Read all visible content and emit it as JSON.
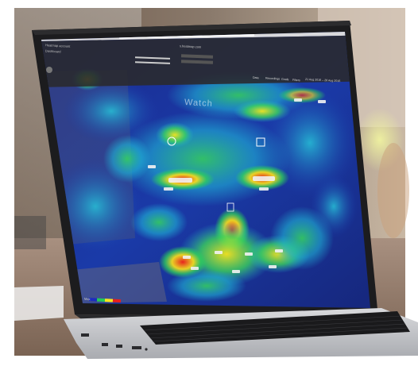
{
  "browser": {
    "url": "s.heatmap.com"
  },
  "app": {
    "account": "Heatmap account",
    "section": "Dashboard",
    "nav": [
      "Data",
      "Recordings",
      "Goals",
      "Filters",
      "21 Aug 2016 – 28 Aug 2016"
    ]
  },
  "page": {
    "hero_title": "Watch"
  },
  "legend": {
    "label": "Max"
  },
  "colors": {
    "bezel": "#1c1c1e",
    "heat_low": "#1e2dbe",
    "heat_mid": "#23c85a",
    "heat_high": "#f5e61e",
    "heat_peak": "#e61e1e",
    "keyboard": "#1a1a1c",
    "aluminium": "#c8c9cc"
  }
}
